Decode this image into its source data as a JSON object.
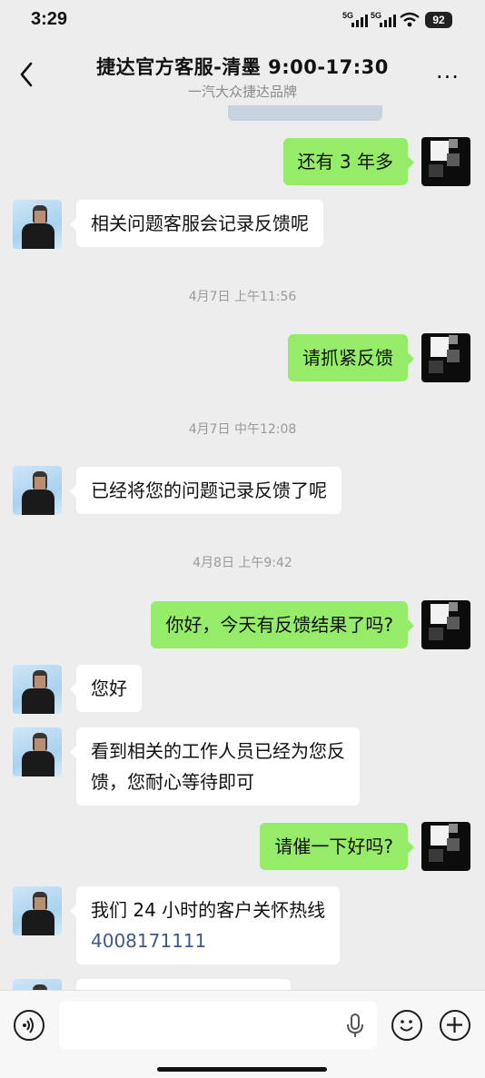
{
  "status_bar": {
    "time": "3:29",
    "signal1": "5G",
    "signal2": "5G",
    "battery": "92"
  },
  "header": {
    "title": "捷达官方客服-清墨 9:00-17:30",
    "subtitle": "一汽大众捷达品牌",
    "back_icon": "chevron-left-icon",
    "more_icon": "more-icon",
    "more_label": "···"
  },
  "messages": [
    {
      "side": "out",
      "text": "还有 3 年多"
    },
    {
      "side": "in",
      "text": "相关问题客服会记录反馈呢"
    },
    {
      "type": "time",
      "text": "4月7日 上午11:56"
    },
    {
      "side": "out",
      "text": "请抓紧反馈"
    },
    {
      "type": "time",
      "text": "4月7日 中午12:08"
    },
    {
      "side": "in",
      "text": "已经将您的问题记录反馈了呢"
    },
    {
      "type": "time",
      "text": "4月8日 上午9:42"
    },
    {
      "side": "out",
      "text": "你好，今天有反馈结果了吗?"
    },
    {
      "side": "in",
      "text": "您好"
    },
    {
      "side": "in",
      "text_line1": "看到相关的工作人员已经为您反",
      "text_line2": "馈，您耐心等待即可"
    },
    {
      "side": "out",
      "text": "请催一下好吗?"
    },
    {
      "side": "in",
      "text_line1": "我们 24 小时的客户关怀热线",
      "phone": "4008171111"
    }
  ],
  "input_bar": {
    "voice_icon": "voice-icon",
    "mic_icon": "microphone-icon",
    "emoji_icon": "emoji-icon",
    "add_icon": "plus-icon",
    "text_value": ""
  },
  "colors": {
    "out_bubble": "#95ec69",
    "in_bubble": "#ffffff",
    "background": "#ededed",
    "link": "#3d5a86"
  }
}
